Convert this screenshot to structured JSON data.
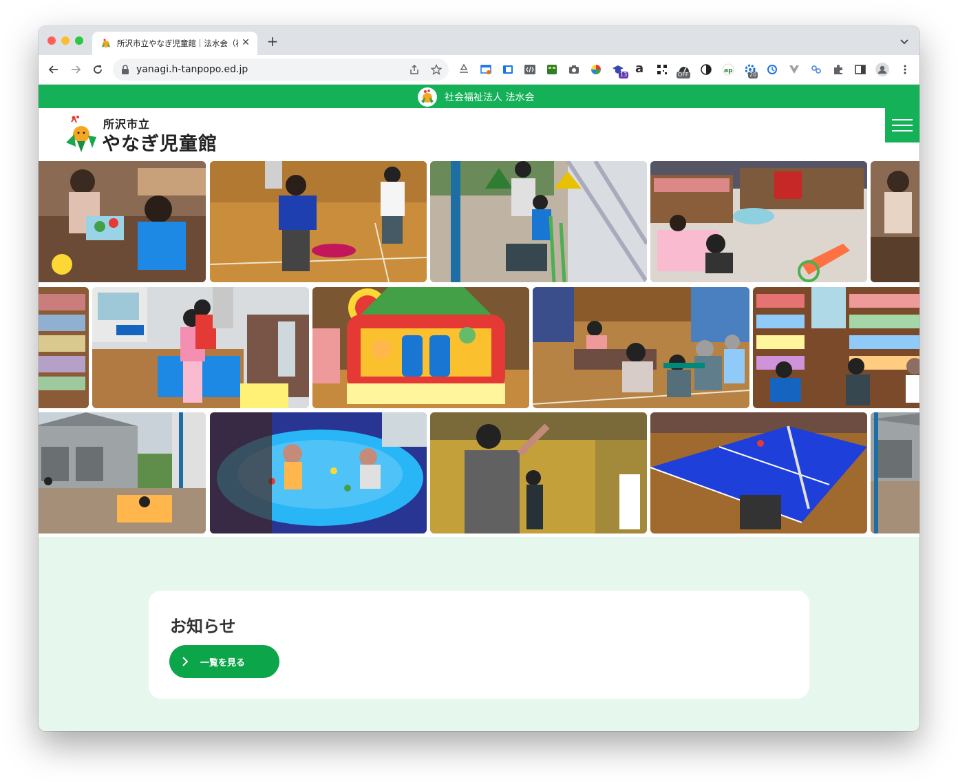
{
  "browser": {
    "tab_title": "所沢市立やなぎ児童館｜法水会（福",
    "url": "yanagi.h-tanpopo.ed.jp",
    "extension_badges": {
      "ext_13": "13",
      "ext_off": "OFF",
      "ext_20": "20"
    },
    "extension_letter": "a"
  },
  "site": {
    "org_name": "社会福祉法人 法水会",
    "city_label": "所沢市立",
    "facility_name": "やなぎ児童館",
    "brand_color": "#14b158",
    "background_color": "#e6f7ee"
  },
  "gallery": {
    "photos": [
      "children-crafts",
      "gym-game",
      "outdoor-garden",
      "play-room-blurred",
      "partial-right",
      "bookshelf-left",
      "reception-desk",
      "bouncy-house",
      "gym-floor-group",
      "library-reading",
      "building-courtyard",
      "pool-play",
      "badminton",
      "table-tennis",
      "partial-building"
    ]
  },
  "news": {
    "title": "お知らせ",
    "button_label": "一覧を見る"
  }
}
